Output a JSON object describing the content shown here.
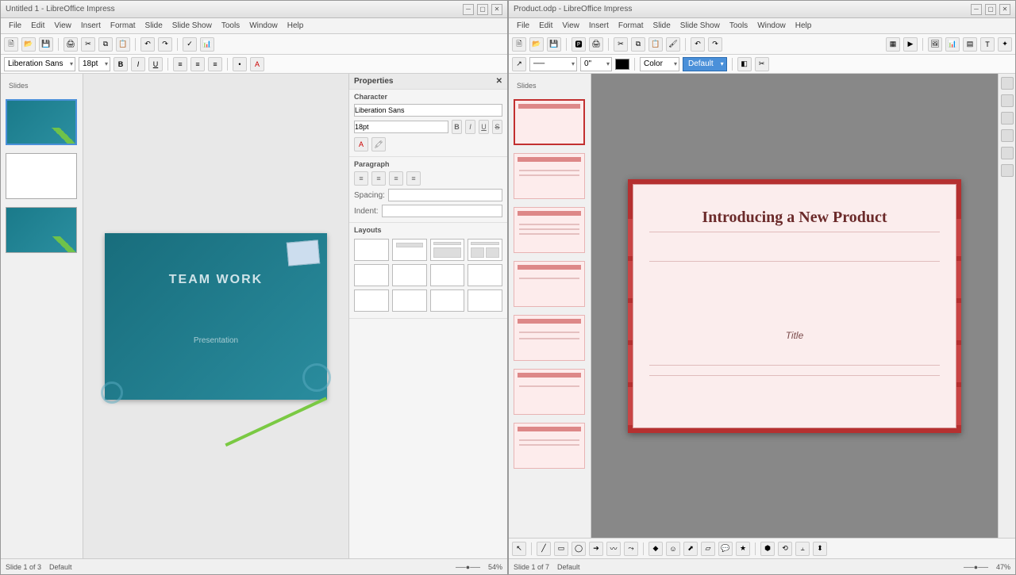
{
  "left_app": {
    "title": "Untitled 1 - LibreOffice Impress",
    "menu": [
      "File",
      "Edit",
      "View",
      "Insert",
      "Format",
      "Slide",
      "Slide Show",
      "Tools",
      "Window",
      "Help"
    ],
    "thumb_header": "Slides",
    "slide": {
      "title": "TEAM WORK",
      "subtitle": "Presentation"
    },
    "panel": {
      "title": "Properties",
      "char_label": "Character",
      "font_name": "Liberation Sans",
      "font_size": "18pt",
      "para_label": "Paragraph",
      "spacing_label": "Spacing:",
      "indent_label": "Indent:",
      "layouts_label": "Layouts"
    },
    "status": {
      "slide": "Slide 1 of 3",
      "template": "Default",
      "zoom": "54%"
    }
  },
  "right_app": {
    "title": "Product.odp - LibreOffice Impress",
    "menu": [
      "File",
      "Edit",
      "View",
      "Insert",
      "Format",
      "Slide",
      "Slide Show",
      "Tools",
      "Window",
      "Help"
    ],
    "thumb_header": "Slides",
    "color_fill_label": "Color",
    "style_combo": "Default",
    "slide": {
      "title": "Introducing a New Product",
      "subtitle": "Title"
    },
    "status": {
      "slide": "Slide 1 of 7",
      "template": "Default",
      "zoom": "47%"
    }
  }
}
